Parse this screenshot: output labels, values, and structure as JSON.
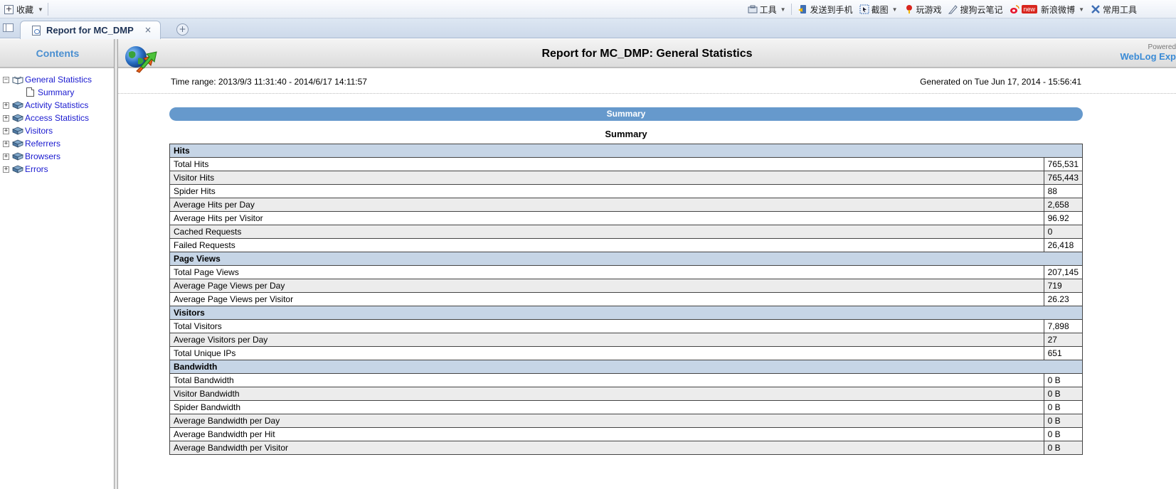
{
  "toolbar": {
    "favorites_label": "收藏",
    "tools": [
      {
        "icon": "toolbox-icon",
        "label": "工具",
        "dropdown": true
      },
      {
        "icon": "send-to-phone-icon",
        "label": "发送到手机",
        "dropdown": false
      },
      {
        "icon": "screenshot-icon",
        "label": "截图",
        "dropdown": true
      },
      {
        "icon": "games-icon",
        "label": "玩游戏",
        "dropdown": false
      },
      {
        "icon": "cloud-note-icon",
        "label": "搜狗云笔记",
        "dropdown": false
      },
      {
        "icon": "weibo-icon",
        "label": "新浪微博",
        "badge": "new",
        "dropdown": true
      },
      {
        "icon": "common-tools-icon",
        "label": "常用工具",
        "dropdown": false
      }
    ]
  },
  "tab": {
    "title": "Report for MC_DMP",
    "close_glyph": "×",
    "new_tab_glyph": "+"
  },
  "contents": {
    "title": "Contents",
    "tree": [
      {
        "label": "General Statistics",
        "expander": "−",
        "expanded": true
      },
      {
        "label": "Summary",
        "child": true
      },
      {
        "label": "Activity Statistics",
        "expander": "+"
      },
      {
        "label": "Access Statistics",
        "expander": "+"
      },
      {
        "label": "Visitors",
        "expander": "+"
      },
      {
        "label": "Referrers",
        "expander": "+"
      },
      {
        "label": "Browsers",
        "expander": "+"
      },
      {
        "label": "Errors",
        "expander": "+"
      }
    ]
  },
  "report": {
    "title": "Report for MC_DMP: General Statistics",
    "powered_by": "Powered",
    "brand": "WebLog Exp",
    "time_range": "Time range: 2013/9/3 11:31:40 - 2014/6/17 14:11:57",
    "generated": "Generated on Tue Jun 17, 2014 - 15:56:41",
    "section_title": "Summary",
    "table_title": "Summary",
    "groups": [
      {
        "name": "Hits",
        "rows": [
          {
            "label": "Total Hits",
            "value": "765,531"
          },
          {
            "label": "Visitor Hits",
            "value": "765,443"
          },
          {
            "label": "Spider Hits",
            "value": "88"
          },
          {
            "label": "Average Hits per Day",
            "value": "2,658"
          },
          {
            "label": "Average Hits per Visitor",
            "value": "96.92"
          },
          {
            "label": "Cached Requests",
            "value": "0"
          },
          {
            "label": "Failed Requests",
            "value": "26,418"
          }
        ]
      },
      {
        "name": "Page Views",
        "rows": [
          {
            "label": "Total Page Views",
            "value": "207,145"
          },
          {
            "label": "Average Page Views per Day",
            "value": "719"
          },
          {
            "label": "Average Page Views per Visitor",
            "value": "26.23"
          }
        ]
      },
      {
        "name": "Visitors",
        "rows": [
          {
            "label": "Total Visitors",
            "value": "7,898"
          },
          {
            "label": "Average Visitors per Day",
            "value": "27"
          },
          {
            "label": "Total Unique IPs",
            "value": "651"
          }
        ]
      },
      {
        "name": "Bandwidth",
        "rows": [
          {
            "label": "Total Bandwidth",
            "value": "0 B"
          },
          {
            "label": "Visitor Bandwidth",
            "value": "0 B"
          },
          {
            "label": "Spider Bandwidth",
            "value": "0 B"
          },
          {
            "label": "Average Bandwidth per Day",
            "value": "0 B"
          },
          {
            "label": "Average Bandwidth per Hit",
            "value": "0 B"
          },
          {
            "label": "Average Bandwidth per Visitor",
            "value": "0 B"
          }
        ]
      }
    ]
  },
  "colors": {
    "section_bar": "#6699cc",
    "group_row": "#c6d5e6",
    "link": "#1a1ad0",
    "contents_title": "#4a8fd0"
  }
}
